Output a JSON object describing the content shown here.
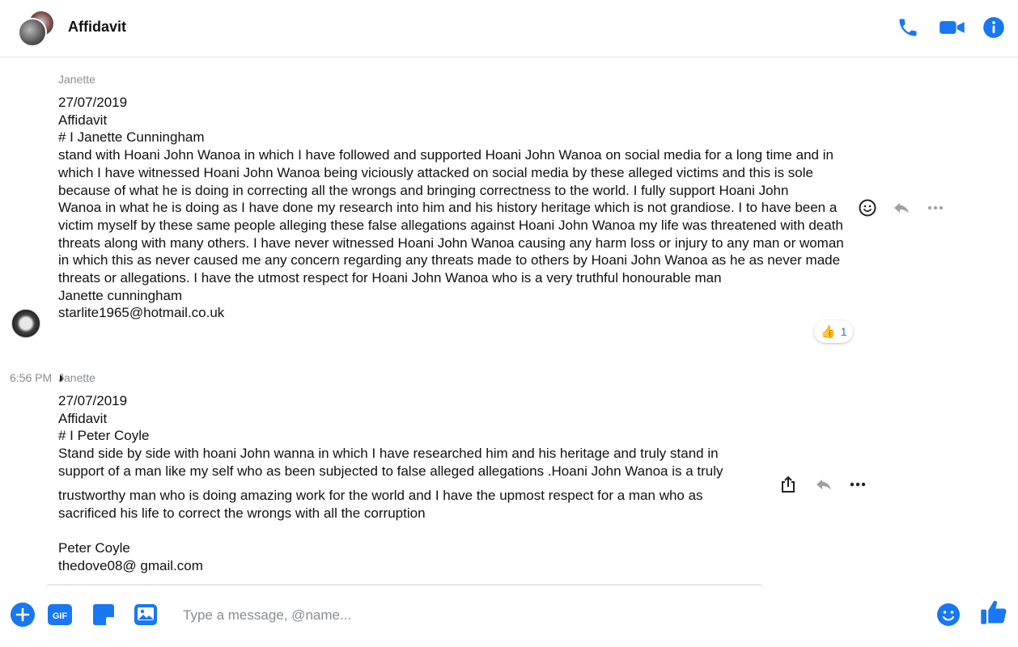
{
  "header": {
    "title": "Affidavit",
    "icons": [
      "phone-icon",
      "video-camera-icon",
      "info-icon"
    ],
    "accent": "#1877f2"
  },
  "messages": [
    {
      "sender": "Janette",
      "lines": [
        "27/07/2019",
        "Affidavit",
        "# I Janette Cunningham",
        "stand with Hoani John Wanoa in which I have followed and supported  Hoani John Wanoa on social media for a long time and in",
        "which I have witnessed Hoani John Wanoa  being viciously attacked on social media by these alleged victims and this is sole",
        "because of what he is doing in correcting all the wrongs and bringing correctness to the world.  I fully support Hoani John",
        "Wanoa in what he is doing as I have done my research into him and his history heritage which is not grandiose. I to have been a",
        "victim myself by these same people alleging these false allegations against Hoani John Wanoa my life was threatened with death",
        "threats along with many others. I have never witnessed Hoani John Wanoa causing any harm loss or injury to any man or woman",
        "in which this as never caused me any concern regarding any threats made to others by Hoani John Wanoa as he as never made",
        "threats or allegations. I have the utmost respect for Hoani John Wanoa who is a very truthful honourable man",
        "Janette cunningham",
        "starlite1965@hotmail.co.uk"
      ],
      "reaction": {
        "emoji": "👍",
        "count": "1"
      },
      "actions": [
        "smiley-icon",
        "reply-icon",
        "more-icon"
      ]
    },
    {
      "timestamp": "6:56 PM",
      "sender": "Janette",
      "lines_a": [
        "27/07/2019",
        "Affidavit",
        "# I Peter Coyle",
        "Stand side by side with hoani John wanna in which I have researched him and his heritage and truly stand in",
        "support of a man like my self who as been subjected to false alleged allegations .Hoani John Wanoa is a truly"
      ],
      "lines_b": [
        "trustworthy man who is doing amazing work for the world and I have the upmost respect for a man who as",
        "sacrificed his life to correct the wrongs with all the corruption",
        "",
        "Peter Coyle",
        "thedove08@ gmail.com"
      ],
      "actions": [
        "share-icon",
        "reply-icon",
        "more-icon"
      ]
    }
  ],
  "composer": {
    "placeholder": "Type a message, @name...",
    "gif_label": "GIF",
    "icons": [
      "add-icon",
      "gif-icon",
      "sticker-icon",
      "image-icon",
      "emoji-icon",
      "thumbs-up-icon"
    ]
  }
}
